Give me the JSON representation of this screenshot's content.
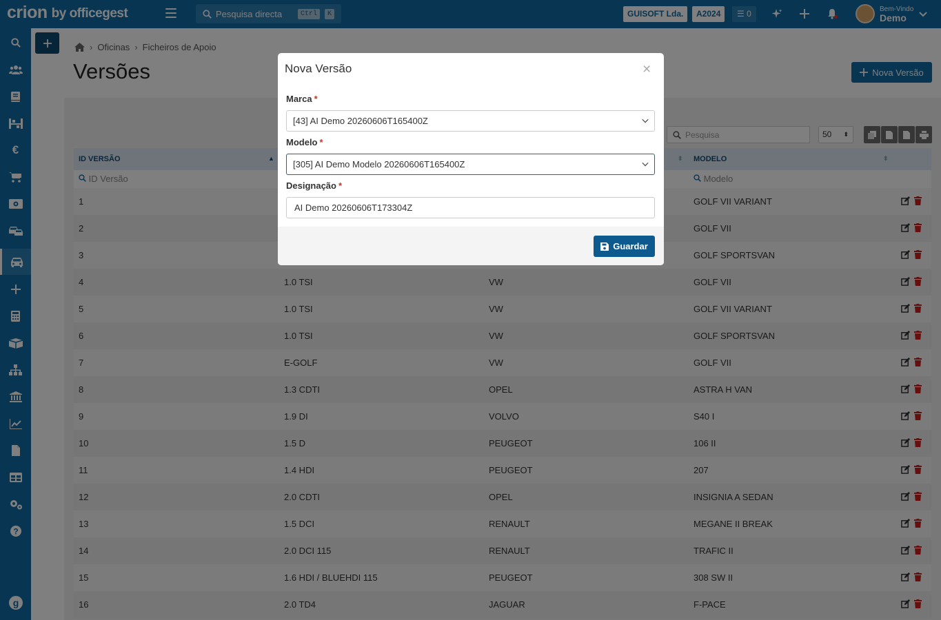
{
  "topbar": {
    "brand": "crion",
    "by_brand": "by officegest",
    "search_placeholder": "Pesquisa directa",
    "kbd_ctrl": "Ctrl",
    "kbd_k": "K",
    "company": "GUISOFT Lda.",
    "year": "A2024",
    "tasks_count": "0",
    "welcome": "Bem-Vindo",
    "user": "Demo"
  },
  "breadcrumb": {
    "home_icon": "home-icon",
    "items": [
      "Oficinas",
      "Ficheiros de Apoio"
    ]
  },
  "page": {
    "title": "Versões",
    "new_button": "Nova Versão"
  },
  "table": {
    "search_placeholder": "Pesquisa",
    "page_size": "50",
    "headers": {
      "id": "ID VERSÃO",
      "modelo": "MODELO"
    },
    "filters": {
      "id": "ID Versão",
      "modelo": "Modelo"
    },
    "rows": [
      {
        "id": "1",
        "versao": "",
        "marca": "",
        "modelo": "GOLF VII VARIANT"
      },
      {
        "id": "2",
        "versao": "",
        "marca": "",
        "modelo": "GOLF VII"
      },
      {
        "id": "3",
        "versao": "",
        "marca": "",
        "modelo": "GOLF SPORTSVAN"
      },
      {
        "id": "4",
        "versao": "1.0 TSI",
        "marca": "VW",
        "modelo": "GOLF VII"
      },
      {
        "id": "5",
        "versao": "1.0 TSI",
        "marca": "VW",
        "modelo": "GOLF VII VARIANT"
      },
      {
        "id": "6",
        "versao": "1.0 TSI",
        "marca": "VW",
        "modelo": "GOLF SPORTSVAN"
      },
      {
        "id": "7",
        "versao": "E-GOLF",
        "marca": "VW",
        "modelo": "GOLF VII"
      },
      {
        "id": "8",
        "versao": "1.3 CDTI",
        "marca": "OPEL",
        "modelo": "ASTRA H VAN"
      },
      {
        "id": "9",
        "versao": "1.9 DI",
        "marca": "VOLVO",
        "modelo": "S40 I"
      },
      {
        "id": "10",
        "versao": "1.5 D",
        "marca": "PEUGEOT",
        "modelo": "106 II"
      },
      {
        "id": "11",
        "versao": "1.4 HDI",
        "marca": "PEUGEOT",
        "modelo": "207"
      },
      {
        "id": "12",
        "versao": "2.0 CDTI",
        "marca": "OPEL",
        "modelo": "INSIGNIA A SEDAN"
      },
      {
        "id": "13",
        "versao": "1.5 DCI",
        "marca": "RENAULT",
        "modelo": "MEGANE II BREAK"
      },
      {
        "id": "14",
        "versao": "2.0 DCI 115",
        "marca": "RENAULT",
        "modelo": "TRAFIC II"
      },
      {
        "id": "15",
        "versao": "1.6 HDI / BLUEHDI 115",
        "marca": "PEUGEOT",
        "modelo": "308 SW II"
      },
      {
        "id": "16",
        "versao": "2.0 TD4",
        "marca": "JAGUAR",
        "modelo": "F-PACE"
      }
    ]
  },
  "modal": {
    "title": "Nova Versão",
    "close": "×",
    "marca_label": "Marca",
    "marca_value": "[43] AI Demo 20260606T165400Z",
    "modelo_label": "Modelo",
    "modelo_value": "[305] AI Demo Modelo 20260606T165400Z",
    "designacao_label": "Designação",
    "designacao_value": "AI Demo 20260606T173304Z",
    "required_mark": "*",
    "save_label": "Guardar"
  },
  "colors": {
    "primary": "#0e6aa5",
    "danger": "#cc1f1f"
  }
}
